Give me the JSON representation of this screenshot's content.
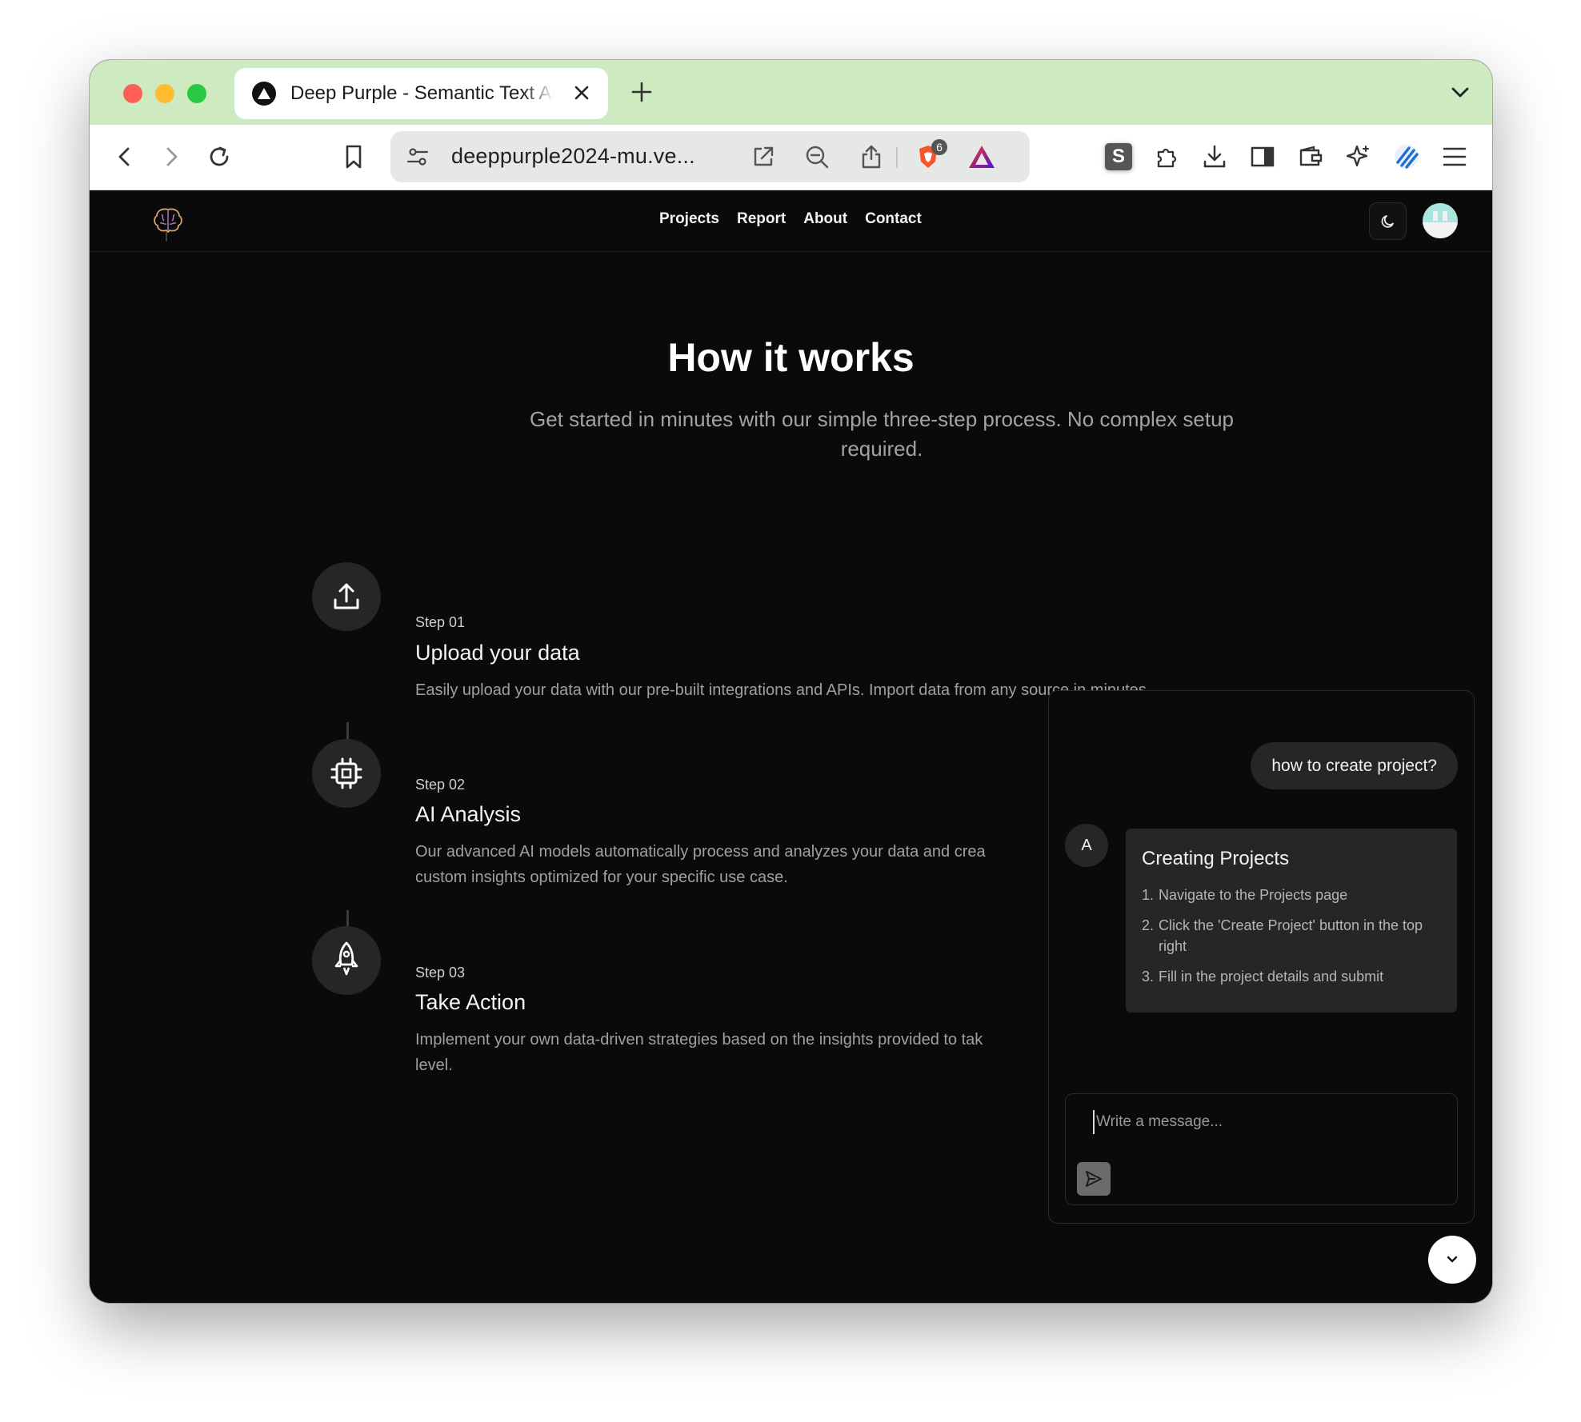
{
  "browser": {
    "tab_title": "Deep Purple - Semantic Text Analysis",
    "url": "deeppurple2024-mu.ve...",
    "shields_badge": "6"
  },
  "site": {
    "nav": [
      "Projects",
      "Report",
      "About",
      "Contact"
    ]
  },
  "hero": {
    "title": "How it works",
    "subtitle": "Get started in minutes with our simple three-step process. No complex setup required."
  },
  "steps": [
    {
      "label": "Step 01",
      "title": "Upload your data",
      "desc_lines": [
        "Easily upload your data with our pre-built integrations and APIs. Import data from any source in minutes."
      ],
      "icon": "upload-icon"
    },
    {
      "label": "Step 02",
      "title": "AI Analysis",
      "desc_lines": [
        "Our advanced AI models automatically process and analyzes your data and crea",
        "custom insights optimized for your specific use case."
      ],
      "icon": "cpu-icon"
    },
    {
      "label": "Step 03",
      "title": "Take Action",
      "desc_lines": [
        "Implement your own data-driven strategies based on the insights provided to tak",
        "level."
      ],
      "icon": "rocket-icon"
    }
  ],
  "chat": {
    "user_message": "how to create project?",
    "bot_avatar": "A",
    "bot_title": "Creating Projects",
    "bot_items": [
      {
        "num": "1.",
        "text": "Navigate to the Projects page"
      },
      {
        "num": "2.",
        "text": "Click the 'Create Project' button in the top right"
      },
      {
        "num": "3.",
        "text": "Fill in the project details and submit"
      }
    ],
    "input_placeholder": "Write a message..."
  },
  "colors": {
    "titlebar": "#cdeac0",
    "page_bg": "#0a0a0b",
    "card": "#262628",
    "text_muted": "#a3a3a3"
  }
}
